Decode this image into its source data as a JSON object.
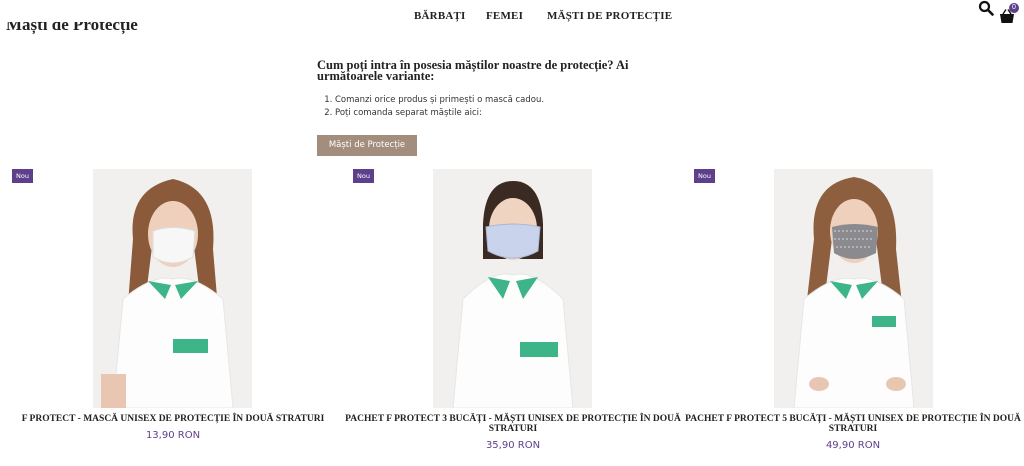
{
  "nav": {
    "items": [
      {
        "label": "BĂRBAȚI"
      },
      {
        "label": "FEMEI"
      },
      {
        "label": "MĂȘTI DE PROTECȚIE"
      }
    ],
    "cart_count": "0"
  },
  "page": {
    "title": "Măști de Protecție"
  },
  "info": {
    "heading": "Cum poți intra în posesia măștilor noastre de protecție? Ai următoarele variante:",
    "options": [
      "Comanzi orice produs și primești o mască cadou.",
      "Poți comanda separat măștile aici:"
    ],
    "cta_label": "Măști de Protecție"
  },
  "products": [
    {
      "badge": "Nou",
      "title": "F PROTECT - MASCĂ UNISEX DE PROTECȚIE ÎN DOUĂ STRATURI",
      "price": "13,90 RON",
      "mask_color": "#f7f7f7"
    },
    {
      "badge": "Nou",
      "title": "PACHET F PROTECT 3 BUCĂȚI - MĂȘTI UNISEX DE PROTECȚIE ÎN DOUĂ STRATURI",
      "price": "35,90 RON",
      "mask_color": "#c9d4ec"
    },
    {
      "badge": "Nou",
      "title": "PACHET F PROTECT 5 BUCĂȚI - MĂȘTI UNISEX DE PROTECȚIE ÎN DOUĂ STRATURI",
      "price": "49,90 RON",
      "mask_color": "#8a8a8f"
    }
  ],
  "colors": {
    "accent_purple": "#5e3f8c",
    "button_taupe": "#a38e7e",
    "uniform_green": "#3eb489"
  }
}
